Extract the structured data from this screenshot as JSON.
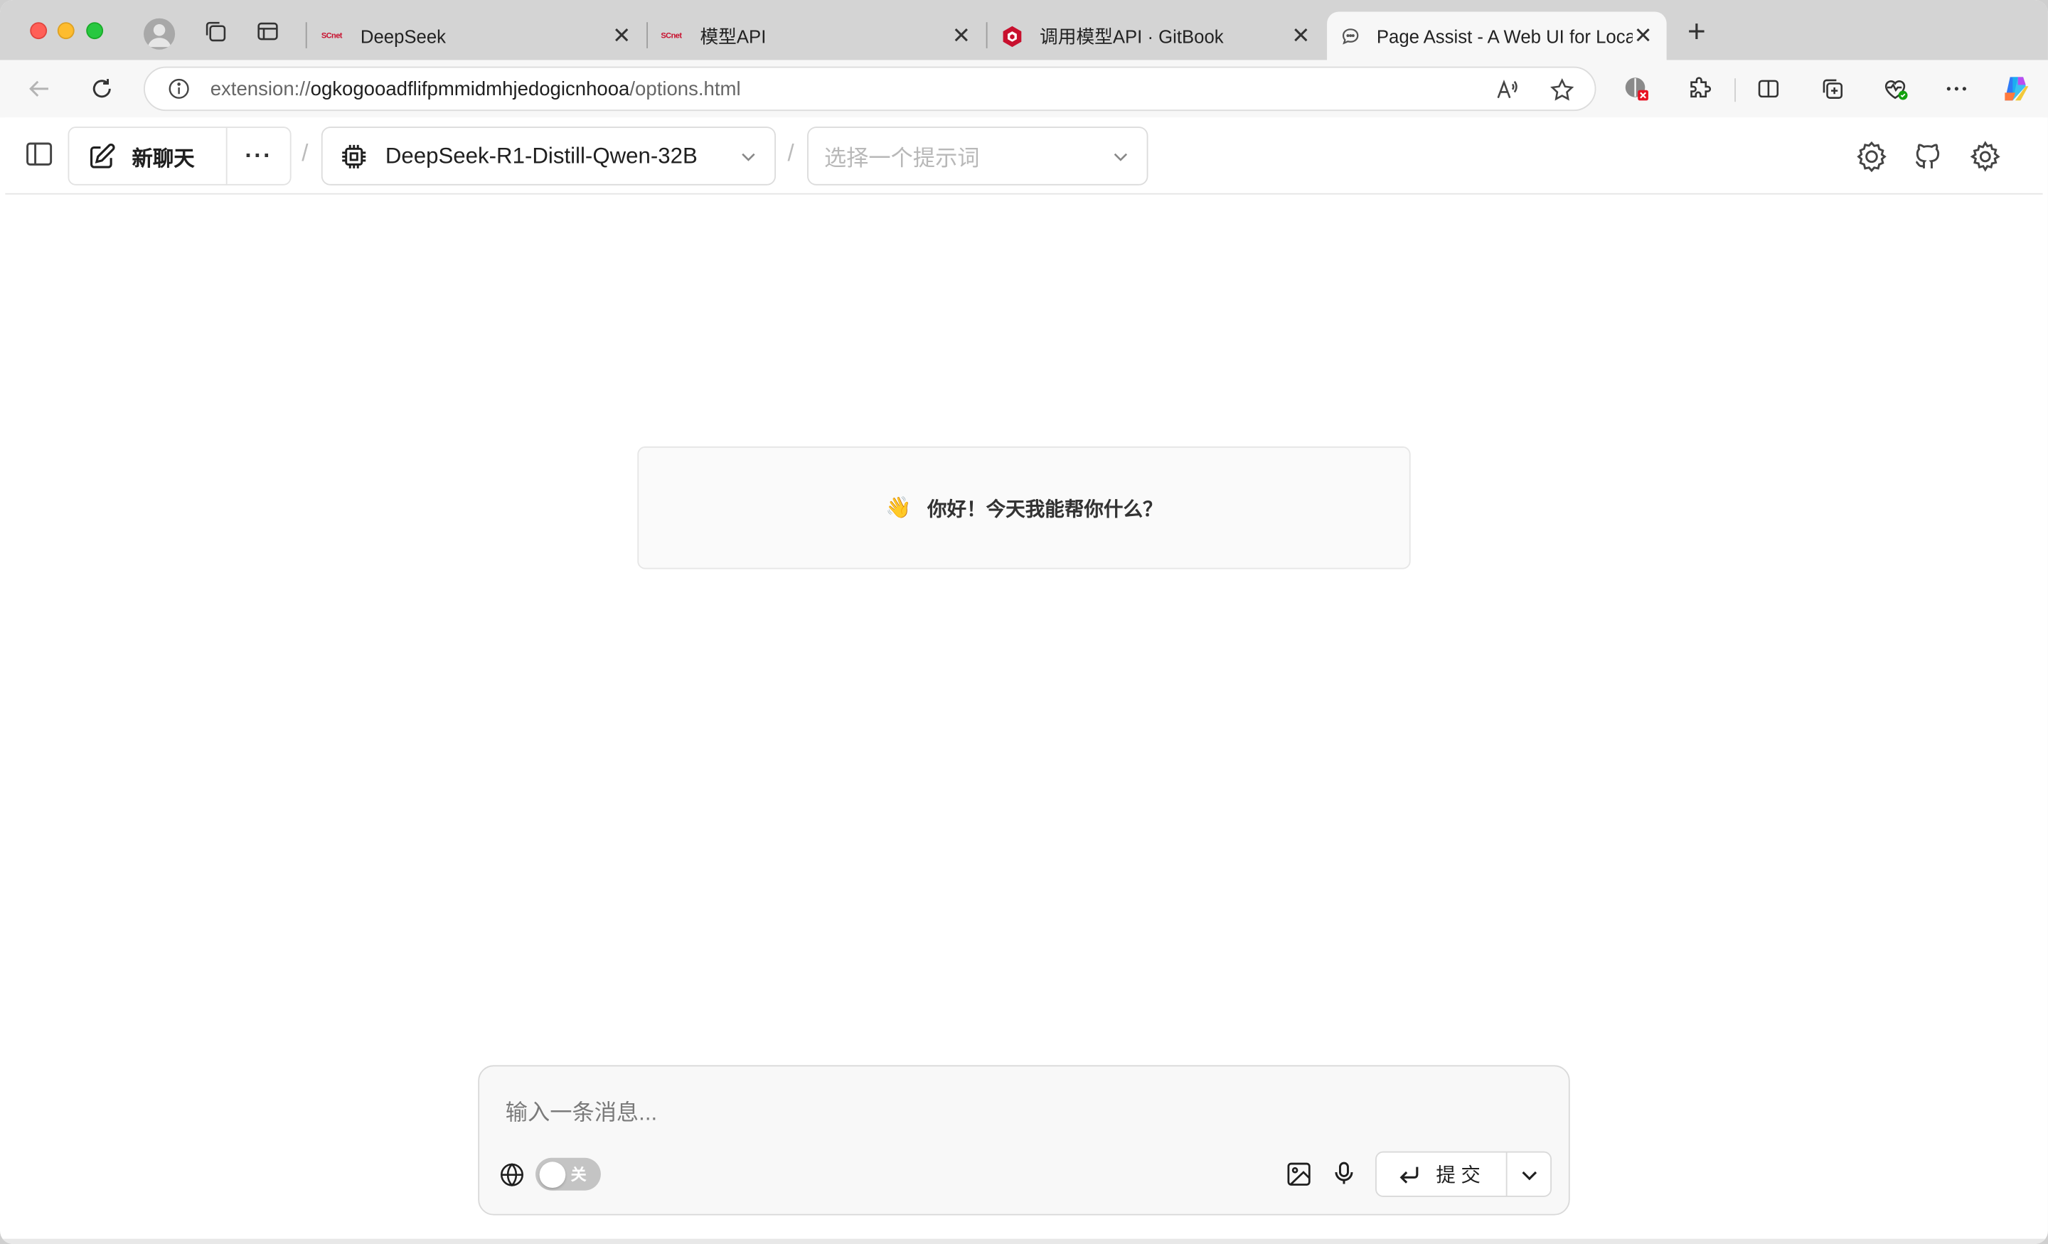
{
  "browser": {
    "tabs": [
      {
        "title": "DeepSeek",
        "favicon": "scnet-icon",
        "active": false
      },
      {
        "title": "模型API",
        "favicon": "scnet-icon",
        "active": false
      },
      {
        "title": "调用模型API · GitBook",
        "favicon": "gitbook-icon",
        "active": false
      },
      {
        "title": "Page Assist - A Web UI for Local AI Models",
        "favicon": "chat-bubble-icon",
        "active": true
      }
    ],
    "favicon_text": "SCnet",
    "new_tab_label": "+",
    "close_glyph": "✕",
    "address": {
      "scheme": "extension://",
      "host": "ogkogooadflifpmmidmhjedogicnhooa",
      "path": "/options.html"
    }
  },
  "app": {
    "new_chat_label": "新聊天",
    "more_label": "···",
    "separator": "/",
    "model": "DeepSeek-R1-Distill-Qwen-32B",
    "prompt_placeholder": "选择一个提示词",
    "greeting": {
      "emoji": "👋",
      "text": "你好！今天我能帮你什么？"
    },
    "composer": {
      "placeholder": "输入一条消息...",
      "toggle_label": "关",
      "toggle_on": false,
      "submit_label": "提交"
    }
  },
  "colors": {
    "tab_strip": "#d4d4d4",
    "toolbar": "#f7f7f7",
    "accent_red": "#c8102e"
  }
}
